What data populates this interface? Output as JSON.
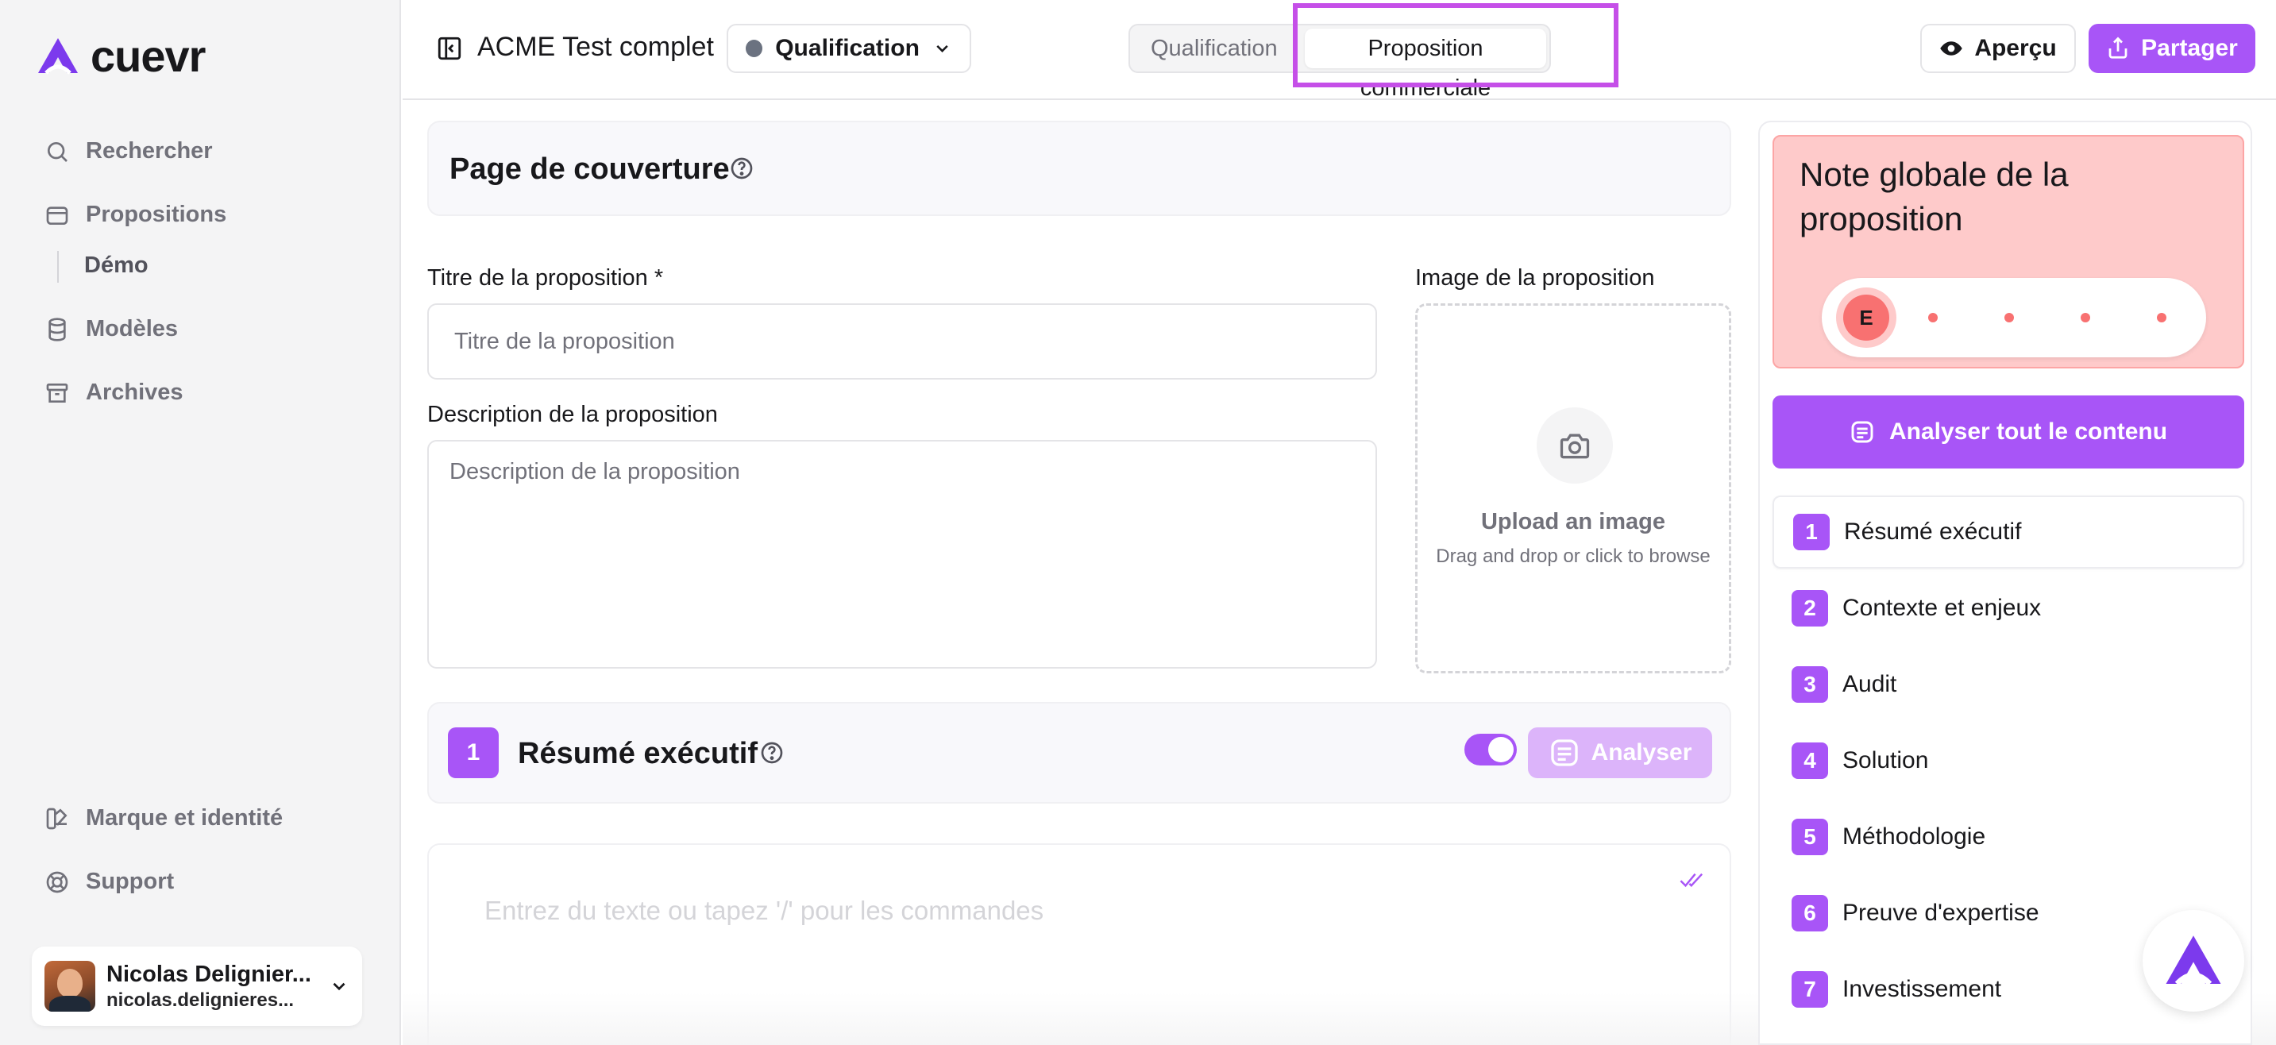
{
  "brand": {
    "name": "cuevr",
    "accent": "#a855f7",
    "highlight": "#c54fe8"
  },
  "sidebar": {
    "nav": [
      {
        "label": "Rechercher",
        "icon": "search-icon"
      },
      {
        "label": "Propositions",
        "icon": "proposals-icon"
      },
      {
        "label": "Démo",
        "icon": ""
      },
      {
        "label": "Modèles",
        "icon": "database-icon"
      },
      {
        "label": "Archives",
        "icon": "archive-icon"
      }
    ],
    "bottom_nav": [
      {
        "label": "Marque et identité",
        "icon": "brand-icon"
      },
      {
        "label": "Support",
        "icon": "lifebuoy-icon"
      }
    ],
    "user": {
      "name": "Nicolas Delignier...",
      "email": "nicolas.delignieres..."
    }
  },
  "header": {
    "doc_title": "ACME Test complet",
    "status": {
      "label": "Qualification",
      "color": "#6b7280"
    },
    "tabs": [
      "Qualification",
      "Proposition commerciale"
    ],
    "active_tab": "Proposition commerciale",
    "preview_label": "Aperçu",
    "share_label": "Partager"
  },
  "cover": {
    "title": "Page de couverture",
    "title_label": "Titre de la proposition *",
    "title_placeholder": "Titre de la proposition",
    "description_label": "Description de la proposition",
    "description_placeholder": "Description de la proposition",
    "image_label": "Image de la proposition",
    "upload_title": "Upload an image",
    "upload_sub": "Drag and drop or click to browse"
  },
  "section": {
    "number": "1",
    "title": "Résumé exécutif",
    "toggle_on": true,
    "analyze_label": "Analyser",
    "editor_placeholder": "Entrez du texte ou tapez '/' pour les commandes"
  },
  "score": {
    "title": "Note globale de la proposition",
    "grade": "E",
    "level_index": 0,
    "levels": 5,
    "color": "#f87171"
  },
  "right_panel": {
    "analyze_all_label": "Analyser tout le contenu",
    "toc": [
      {
        "num": "1",
        "label": "Résumé exécutif"
      },
      {
        "num": "2",
        "label": "Contexte et enjeux"
      },
      {
        "num": "3",
        "label": "Audit"
      },
      {
        "num": "4",
        "label": "Solution"
      },
      {
        "num": "5",
        "label": "Méthodologie"
      },
      {
        "num": "6",
        "label": "Preuve d'expertise"
      },
      {
        "num": "7",
        "label": "Investissement"
      }
    ]
  }
}
